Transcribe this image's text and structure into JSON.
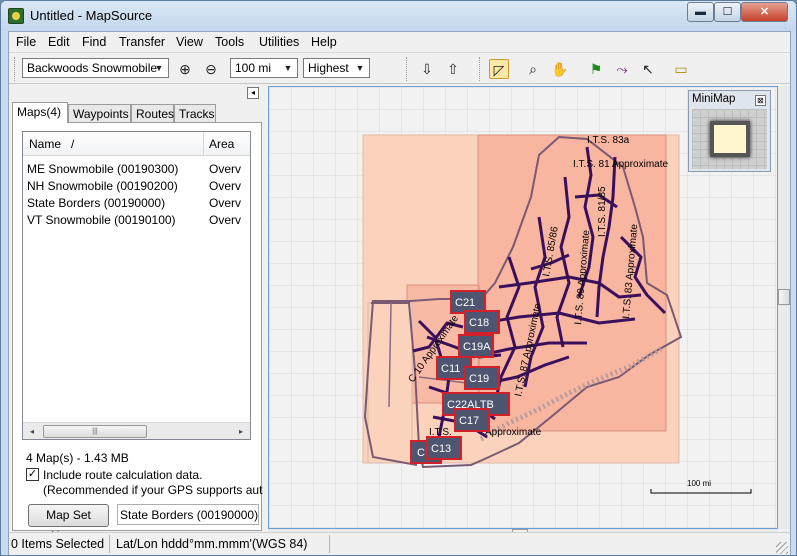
{
  "window": {
    "title": "Untitled - MapSource",
    "min_glyph": "▬",
    "max_glyph": "☐",
    "close_glyph": "✕"
  },
  "menu": [
    "File",
    "Edit",
    "Find",
    "Transfer",
    "View",
    "Tools",
    "Utilities",
    "Help"
  ],
  "toolbar": {
    "product_combo": "Backwoods Snowmobile",
    "zoom_in_glyph": "⊕",
    "zoom_out_glyph": "⊖",
    "scale_combo": "100 mi",
    "detail_combo": "Highest",
    "icons": [
      {
        "name": "receive-from-device-icon",
        "glyph": "⇩"
      },
      {
        "name": "send-to-device-icon",
        "glyph": "⇧"
      },
      {
        "name": "map-select-tool-icon",
        "glyph": "◸"
      },
      {
        "name": "zoom-tool-icon",
        "glyph": "⌕"
      },
      {
        "name": "hand-pan-tool-icon",
        "glyph": "✋"
      },
      {
        "name": "waypoint-flag-tool-icon",
        "glyph": "⚑"
      },
      {
        "name": "route-tool-icon",
        "glyph": "⤳"
      },
      {
        "name": "selection-arrow-tool-icon",
        "glyph": "↖"
      },
      {
        "name": "distance-ruler-tool-icon",
        "glyph": "▭"
      }
    ]
  },
  "left_panel": {
    "collapse_glyph": "◂",
    "tabs": [
      "Maps(4)",
      "Waypoints",
      "Routes",
      "Tracks"
    ],
    "selected_tab": "Maps(4)",
    "list": {
      "columns": [
        "Name",
        "/",
        "Area"
      ],
      "rows": [
        {
          "name": "ME Snowmobile (00190300)",
          "area": "Overv"
        },
        {
          "name": "NH Snowmobile (00190200)",
          "area": "Overv"
        },
        {
          "name": "State Borders (00190000)",
          "area": "Overv"
        },
        {
          "name": "VT Snowmobile (00190100)",
          "area": "Overv"
        }
      ],
      "scroll_left_glyph": "◂",
      "scroll_right_glyph": "▸",
      "scroll_thumb_glyph": "|||"
    },
    "map_count": "4 Map(s) - 1.43 MB",
    "route_calc_checked": true,
    "checkbox_glyph": "✓",
    "route_calc_label": "Include route calculation data.",
    "route_calc_note": "(Recommended if your GPS supports auto-ro",
    "map_set_button": "Map Set Name:",
    "map_set_value": "State Borders (00190000)"
  },
  "map": {
    "labels": [
      "I.T.S. 83a",
      "I.T.S. 81 Approximate",
      "I.T.S. 81/85",
      "I.T.S. 83 Approximate",
      "I.T.S. 85/86",
      "I.T.S. 89 Approximate",
      "I.T.S. 87 Approximate",
      "C 10 Approximate",
      "Approximate",
      "I.T.S."
    ],
    "tiles": [
      "C21",
      "C18",
      "C19A",
      "C11",
      "C19",
      "C22ALTB",
      "C17",
      "C13",
      "C"
    ],
    "scale_bar": "100 mi",
    "colors": {
      "coverage_light": "#fbd3bd",
      "coverage_dark": "#f6a894",
      "trails": "#3a0f5c",
      "tile": "#4d5570",
      "tile_stripe": "#d4202a"
    }
  },
  "minimap": {
    "title": "MiniMap",
    "close_glyph": "⊠"
  },
  "status": {
    "selected": "0 Items Selected",
    "position_format": "Lat/Lon hddd°mm.mmm'(WGS 84)"
  }
}
